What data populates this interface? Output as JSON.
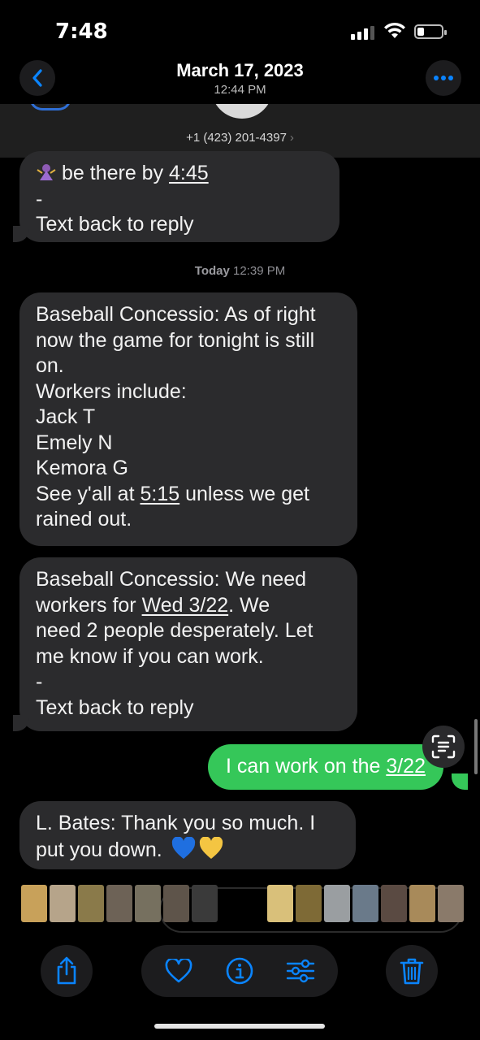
{
  "status_bar": {
    "time": "7:48",
    "battery_level": 0.2
  },
  "viewer_header": {
    "date": "March 17, 2023",
    "time": "12:44 PM"
  },
  "conversation": {
    "contact_number": "+1 (423) 201-4397",
    "messages": [
      {
        "direction": "incoming",
        "lines": [
          "be there by ",
          "4:45",
          "-",
          "Text back to reply"
        ]
      },
      {
        "direction": "timestamp",
        "day": "Today",
        "time": "12:39 PM"
      },
      {
        "direction": "incoming",
        "lines": [
          "Baseball Concessio: As of right",
          "now the game for tonight is still",
          "on.",
          "Workers include:",
          "Jack T",
          "Emely N",
          "Kemora G",
          "See y'all at ",
          "5:15",
          " unless we get",
          "rained out."
        ]
      },
      {
        "direction": "incoming",
        "lines": [
          "Baseball Concessio: We need",
          "workers for ",
          "Wed 3/22",
          ". We",
          "need 2 people desperately. Let",
          "me know if you can work.",
          "-",
          "Text back to reply"
        ]
      },
      {
        "direction": "outgoing",
        "lines": [
          "I can work on the ",
          "3/22"
        ]
      },
      {
        "direction": "incoming",
        "lines": [
          "L. Bates: Thank you so much. I",
          "put you down."
        ]
      }
    ]
  },
  "icons": {
    "back": "chevron-left-icon",
    "more": "ellipsis-icon",
    "live_text": "live-text-icon",
    "share": "share-icon",
    "favorite": "heart-icon",
    "info": "info-icon",
    "adjust": "adjust-icon",
    "delete": "trash-icon"
  },
  "colors": {
    "accent": "#0a84ff",
    "incoming_bubble": "#2b2b2d",
    "outgoing_bubble": "#35c759",
    "blue_heart": "#1f6fe0",
    "yellow_heart": "#f4c542"
  },
  "thumbnails": [
    "#c8a15a",
    "#b6a48a",
    "#8a7a4a",
    "#6d6256",
    "#76705f",
    "#5e544a",
    "#3a3a3a",
    "#d9c07a",
    "#7e6a36",
    "#9a9ea1",
    "#6a7a8a",
    "#5a4a42",
    "#a88a5a",
    "#8a7a6a"
  ]
}
